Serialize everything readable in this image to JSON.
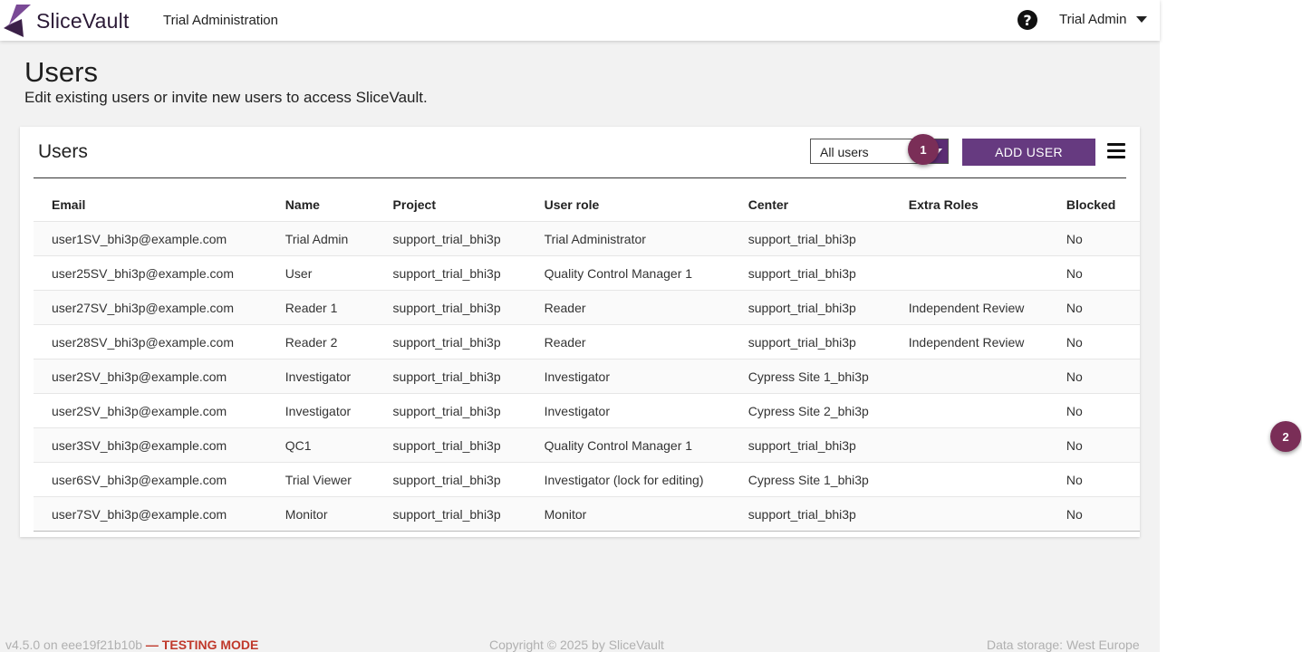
{
  "header": {
    "logo_text": "SliceVault",
    "app_title": "Trial Administration",
    "help_label": "?",
    "user_name": "Trial Admin"
  },
  "page": {
    "title": "Users",
    "subtitle": "Edit existing users or invite new users to access SliceVault."
  },
  "card": {
    "title": "Users",
    "filter_value": "All users",
    "add_button": "ADD USER"
  },
  "table": {
    "columns": [
      "Email",
      "Name",
      "Project",
      "User role",
      "Center",
      "Extra Roles",
      "Blocked"
    ],
    "rows": [
      [
        "user1SV_bhi3p@example.com",
        "Trial Admin",
        "support_trial_bhi3p",
        "Trial Administrator",
        "support_trial_bhi3p",
        "",
        "No"
      ],
      [
        "user25SV_bhi3p@example.com",
        "User",
        "support_trial_bhi3p",
        "Quality Control Manager 1",
        "support_trial_bhi3p",
        "",
        "No"
      ],
      [
        "user27SV_bhi3p@example.com",
        "Reader 1",
        "support_trial_bhi3p",
        "Reader",
        "support_trial_bhi3p",
        "Independent Review",
        "No"
      ],
      [
        "user28SV_bhi3p@example.com",
        "Reader 2",
        "support_trial_bhi3p",
        "Reader",
        "support_trial_bhi3p",
        "Independent Review",
        "No"
      ],
      [
        "user2SV_bhi3p@example.com",
        "Investigator",
        "support_trial_bhi3p",
        "Investigator",
        "Cypress Site 1_bhi3p",
        "",
        "No"
      ],
      [
        "user2SV_bhi3p@example.com",
        "Investigator",
        "support_trial_bhi3p",
        "Investigator",
        "Cypress Site 2_bhi3p",
        "",
        "No"
      ],
      [
        "user3SV_bhi3p@example.com",
        "QC1",
        "support_trial_bhi3p",
        "Quality Control Manager 1",
        "support_trial_bhi3p",
        "",
        "No"
      ],
      [
        "user6SV_bhi3p@example.com",
        "Trial Viewer",
        "support_trial_bhi3p",
        "Investigator (lock for editing)",
        "Cypress Site 1_bhi3p",
        "",
        "No"
      ],
      [
        "user7SV_bhi3p@example.com",
        "Monitor",
        "support_trial_bhi3p",
        "Monitor",
        "support_trial_bhi3p",
        "",
        "No"
      ]
    ]
  },
  "badges": [
    "1",
    "2"
  ],
  "footer": {
    "version": "v4.5.0 on eee19f21b10b",
    "testing": "— TESTING MODE",
    "copyright": "Copyright © 2025 by SliceVault",
    "storage": "Data storage: West Europe"
  },
  "colors": {
    "brand": "#663a80",
    "badge": "#7a2e57",
    "testing": "#c0392b"
  }
}
